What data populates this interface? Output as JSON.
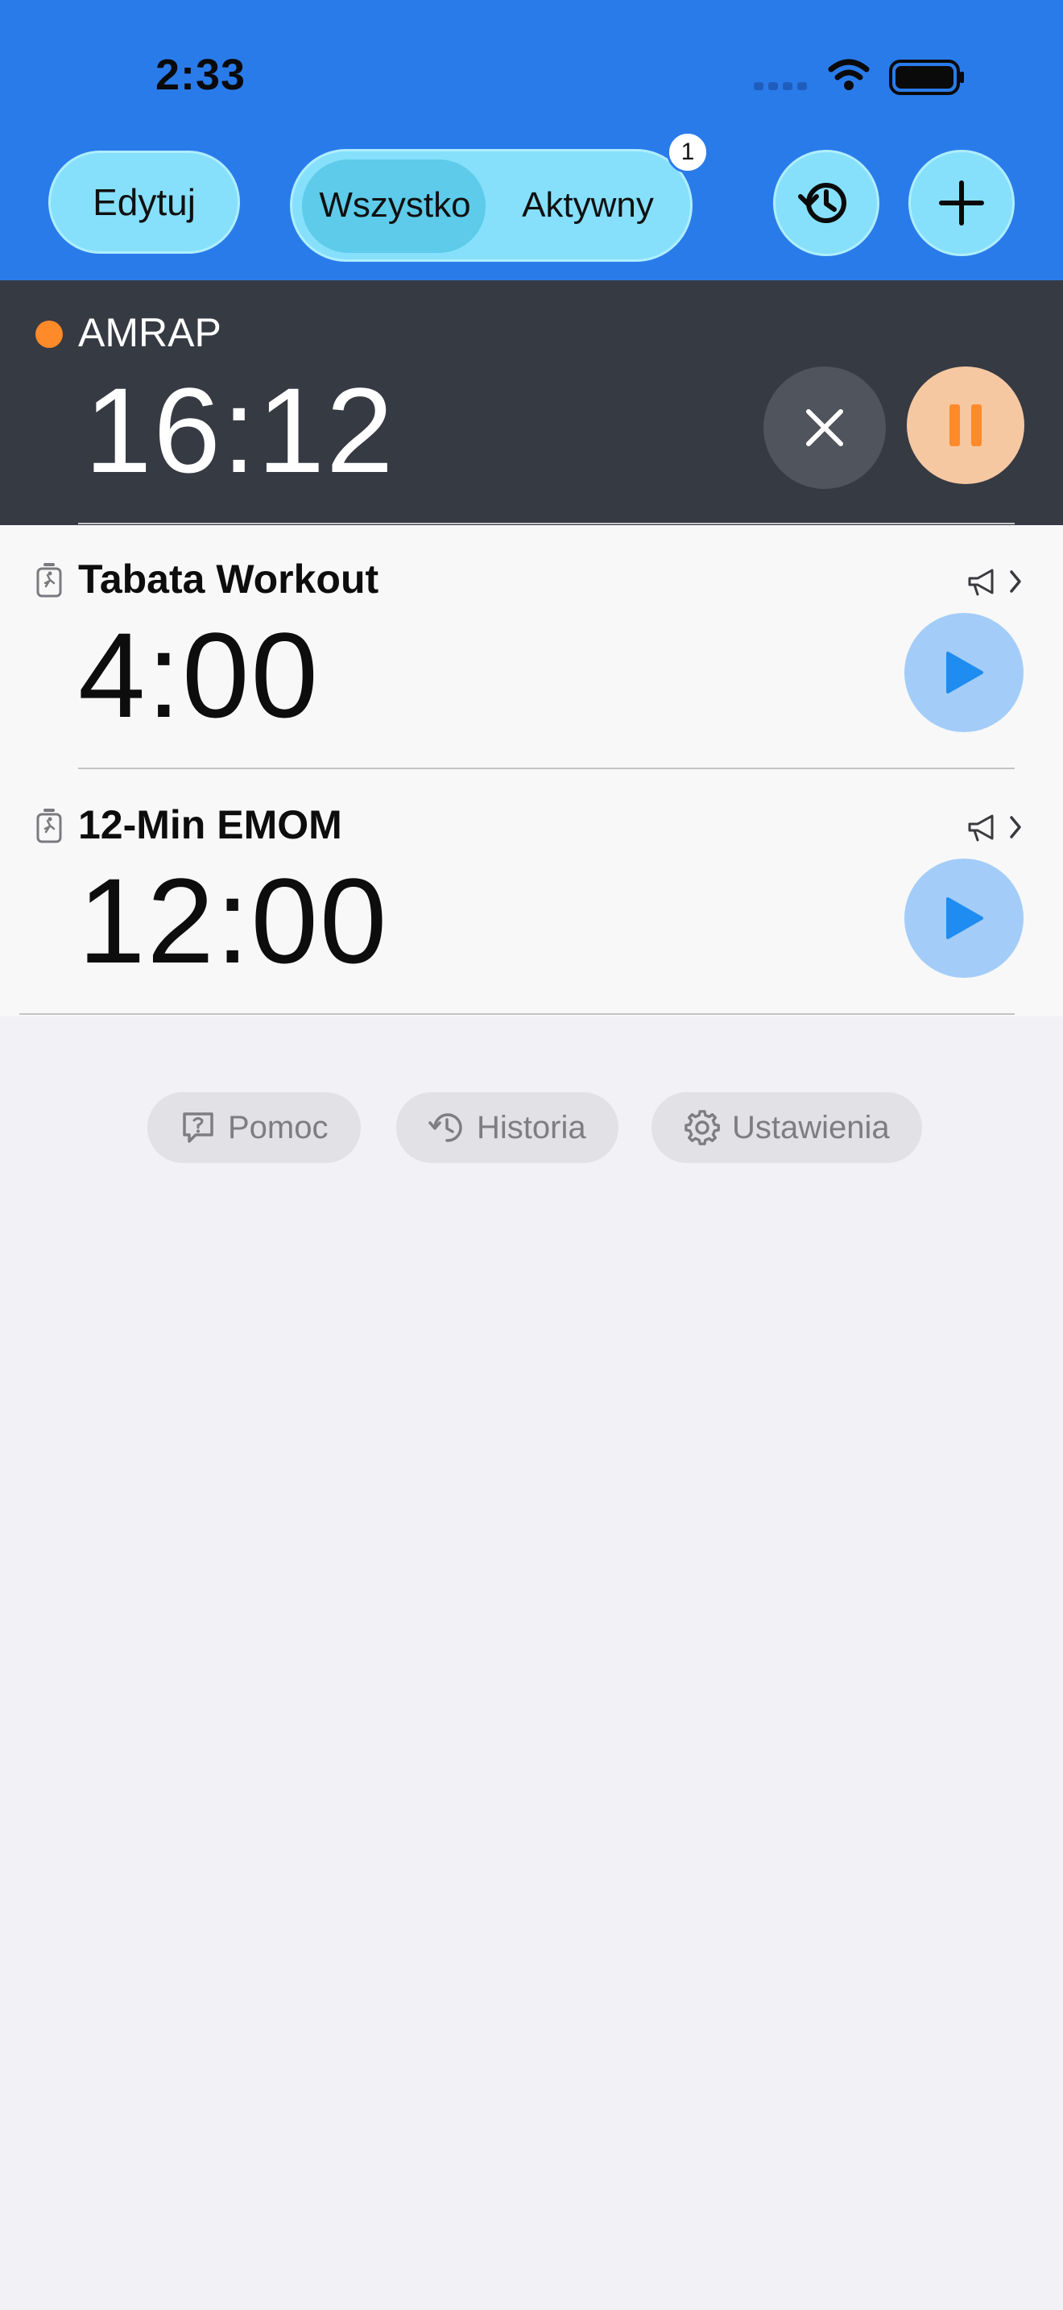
{
  "status_bar": {
    "time": "2:33"
  },
  "toolbar": {
    "edit_label": "Edytuj",
    "segments": [
      {
        "label": "Wszystko",
        "selected": true
      },
      {
        "label": "Aktywny",
        "selected": false
      }
    ],
    "active_badge": "1",
    "history_icon": "clock-arrow-icon",
    "add_icon": "plus-icon"
  },
  "active_timer": {
    "name": "AMRAP",
    "time": "16:12",
    "status_color": "#ff8a2a",
    "cancel_icon": "close-icon",
    "pause_icon": "pause-icon"
  },
  "timers": [
    {
      "name": "Tabata Workout",
      "time": "4:00",
      "icon": "stopwatch-run-icon",
      "meta_icon": "megaphone-icon"
    },
    {
      "name": "12-Min EMOM",
      "time": "12:00",
      "icon": "stopwatch-run-icon",
      "meta_icon": "megaphone-icon"
    }
  ],
  "footer_links": [
    {
      "label": "Pomoc",
      "icon": "question-bubble-icon"
    },
    {
      "label": "Historia",
      "icon": "history-icon"
    },
    {
      "label": "Ustawienia",
      "icon": "gear-icon"
    }
  ],
  "colors": {
    "header": "#2a7bea",
    "button_fill": "#86e0fb",
    "active_card": "#363a43",
    "pause_fill": "#f6c8a2",
    "pause_glyph": "#ff8a2a",
    "play_fill": "#a3cdf8",
    "play_glyph": "#1e8cf0"
  }
}
